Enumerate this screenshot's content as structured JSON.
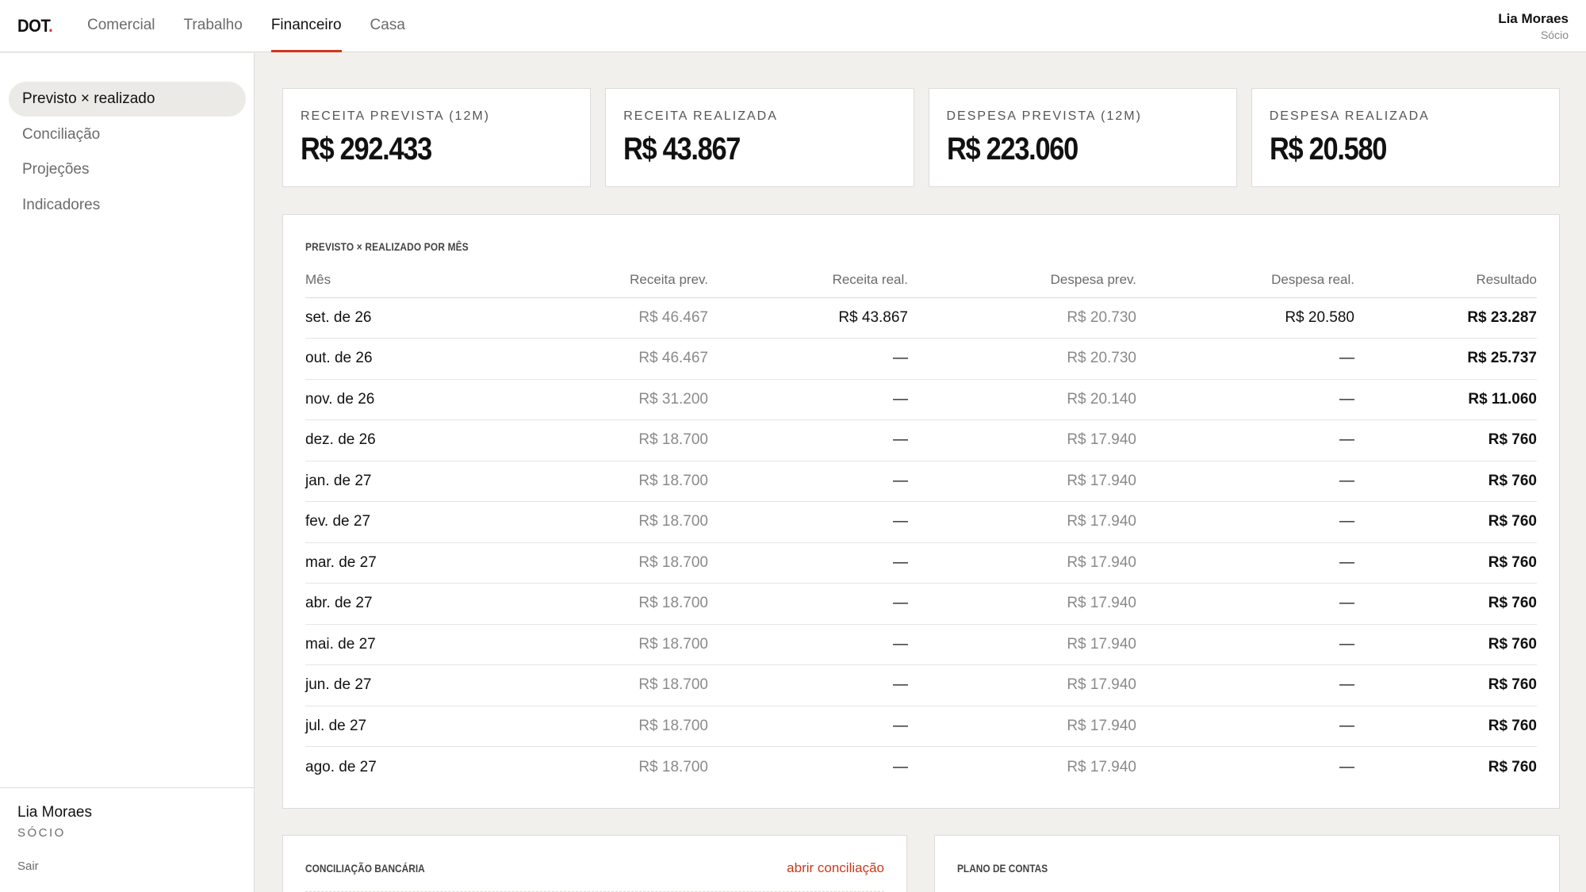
{
  "header": {
    "logo": "DOT",
    "logo_dot": ".",
    "tabs": [
      {
        "label": "Comercial"
      },
      {
        "label": "Trabalho"
      },
      {
        "label": "Financeiro"
      },
      {
        "label": "Casa"
      }
    ],
    "active_tab": "Financeiro",
    "user_name": "Lia Moraes",
    "user_role": "Sócio"
  },
  "sidebar": {
    "items": [
      {
        "label": "Previsto × realizado"
      },
      {
        "label": "Conciliação"
      },
      {
        "label": "Projeções"
      },
      {
        "label": "Indicadores"
      }
    ],
    "active_item": "Previsto × realizado",
    "user_name": "Lia Moraes",
    "user_role": "SÓCIO",
    "logout": "Sair"
  },
  "kpis": [
    {
      "label": "RECEITA PREVISTA (12M)",
      "value": "R$ 292.433"
    },
    {
      "label": "RECEITA REALIZADA",
      "value": "R$ 43.867"
    },
    {
      "label": "DESPESA PREVISTA (12M)",
      "value": "R$ 223.060"
    },
    {
      "label": "DESPESA REALIZADA",
      "value": "R$ 20.580"
    }
  ],
  "table": {
    "title": "PREVISTO × REALIZADO POR MÊS",
    "columns": [
      "Mês",
      "Receita prev.",
      "Receita real.",
      "Despesa prev.",
      "Despesa real.",
      "Resultado"
    ],
    "rows": [
      [
        "set. de 26",
        "R$ 46.467",
        "R$ 43.867",
        "R$ 20.730",
        "R$ 20.580",
        "R$ 23.287"
      ],
      [
        "out. de 26",
        "R$ 46.467",
        "—",
        "R$ 20.730",
        "—",
        "R$ 25.737"
      ],
      [
        "nov. de 26",
        "R$ 31.200",
        "—",
        "R$ 20.140",
        "—",
        "R$ 11.060"
      ],
      [
        "dez. de 26",
        "R$ 18.700",
        "—",
        "R$ 17.940",
        "—",
        "R$ 760"
      ],
      [
        "jan. de 27",
        "R$ 18.700",
        "—",
        "R$ 17.940",
        "—",
        "R$ 760"
      ],
      [
        "fev. de 27",
        "R$ 18.700",
        "—",
        "R$ 17.940",
        "—",
        "R$ 760"
      ],
      [
        "mar. de 27",
        "R$ 18.700",
        "—",
        "R$ 17.940",
        "—",
        "R$ 760"
      ],
      [
        "abr. de 27",
        "R$ 18.700",
        "—",
        "R$ 17.940",
        "—",
        "R$ 760"
      ],
      [
        "mai. de 27",
        "R$ 18.700",
        "—",
        "R$ 17.940",
        "—",
        "R$ 760"
      ],
      [
        "jun. de 27",
        "R$ 18.700",
        "—",
        "R$ 17.940",
        "—",
        "R$ 760"
      ],
      [
        "jul. de 27",
        "R$ 18.700",
        "—",
        "R$ 17.940",
        "—",
        "R$ 760"
      ],
      [
        "ago. de 27",
        "R$ 18.700",
        "—",
        "R$ 17.940",
        "—",
        "R$ 760"
      ]
    ]
  },
  "reconciliation": {
    "title": "CONCILIAÇÃO BANCÁRIA",
    "link": "abrir conciliação"
  },
  "chart_of_accounts": {
    "title": "PLANO DE CONTAS"
  },
  "colors": {
    "accent": "#d4361c",
    "background": "#f1f0ed",
    "card": "#ffffff"
  }
}
